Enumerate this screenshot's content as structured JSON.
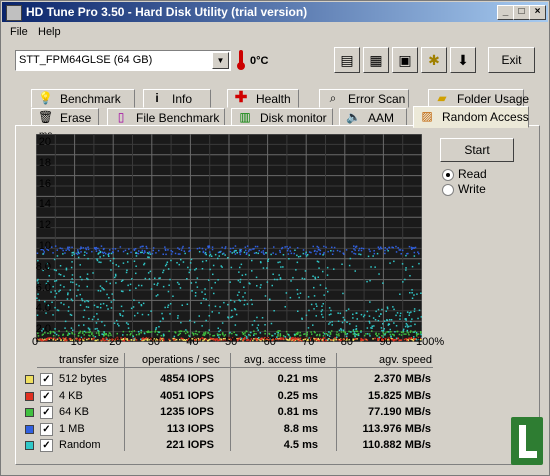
{
  "window": {
    "title": "HD Tune Pro 3.50 - Hard Disk Utility (trial version)"
  },
  "menu": {
    "file": "File",
    "help": "Help"
  },
  "drive": {
    "selected": "STT_FPM64GLSE (64 GB)",
    "temperature": "0°C"
  },
  "toolbar": {
    "icons": [
      "copy-info-icon",
      "copy-screen-icon",
      "save-icon",
      "options-icon",
      "download-icon"
    ],
    "exit_label": "Exit"
  },
  "tabs_row1": [
    {
      "label": "Benchmark",
      "icon": "lightbulb-icon"
    },
    {
      "label": "Info",
      "icon": "info-icon"
    },
    {
      "label": "Health",
      "icon": "health-cross-icon"
    },
    {
      "label": "Error Scan",
      "icon": "magnifier-icon"
    },
    {
      "label": "Folder Usage",
      "icon": "folder-icon"
    }
  ],
  "tabs_row2": [
    {
      "label": "Erase",
      "icon": "trash-icon"
    },
    {
      "label": "File Benchmark",
      "icon": "file-benchmark-icon"
    },
    {
      "label": "Disk monitor",
      "icon": "monitor-icon"
    },
    {
      "label": "AAM",
      "icon": "speaker-icon"
    },
    {
      "label": "Random Access",
      "icon": "random-access-icon",
      "active": true
    }
  ],
  "controls": {
    "start_label": "Start",
    "read_label": "Read",
    "write_label": "Write",
    "mode": "Read"
  },
  "chart_data": {
    "type": "scatter",
    "ylabel": "ms",
    "y_ticks": [
      "20",
      "18",
      "16",
      "14",
      "12",
      "10",
      "8.0",
      "6.0",
      "4.0",
      "2.0"
    ],
    "x_ticks": [
      "0",
      "10",
      "20",
      "30",
      "40",
      "50",
      "60",
      "70",
      "80",
      "90",
      "100%"
    ],
    "xlim": [
      0,
      100
    ],
    "ylim": [
      0,
      20
    ],
    "grid": true,
    "background": "#000000",
    "series": [
      {
        "name": "512 bytes",
        "color": "#f0e060",
        "level_ms": 0.21,
        "spread_ms": 0.1
      },
      {
        "name": "4 KB",
        "color": "#e03020",
        "level_ms": 0.25,
        "spread_ms": 0.15
      },
      {
        "name": "64 KB",
        "color": "#40c040",
        "level_ms": 0.81,
        "spread_ms": 0.25
      },
      {
        "name": "1 MB",
        "color": "#3060e0",
        "level_ms": 8.8,
        "spread_ms": 0.4
      },
      {
        "name": "Random",
        "color": "#30c8c8",
        "level_ms": 4.5,
        "spread_ms": 4.3
      }
    ]
  },
  "table": {
    "headers": [
      "transfer size",
      "operations / sec",
      "avg. access time",
      "agv. speed"
    ],
    "rows": [
      {
        "size": "512 bytes",
        "color": "#f0e060",
        "checked": true,
        "ops": "4854 IOPS",
        "access": "0.21 ms",
        "speed": "2.370 MB/s"
      },
      {
        "size": "4 KB",
        "color": "#e03020",
        "checked": true,
        "ops": "4051 IOPS",
        "access": "0.25 ms",
        "speed": "15.825 MB/s"
      },
      {
        "size": "64 KB",
        "color": "#40c040",
        "checked": true,
        "ops": "1235 IOPS",
        "access": "0.81 ms",
        "speed": "77.190 MB/s"
      },
      {
        "size": "1 MB",
        "color": "#3060e0",
        "checked": true,
        "ops": "113 IOPS",
        "access": "8.8 ms",
        "speed": "113.976 MB/s"
      },
      {
        "size": "Random",
        "color": "#30c8c8",
        "checked": true,
        "ops": "221 IOPS",
        "access": "4.5 ms",
        "speed": "110.882 MB/s"
      }
    ]
  },
  "checkmark": "✓"
}
